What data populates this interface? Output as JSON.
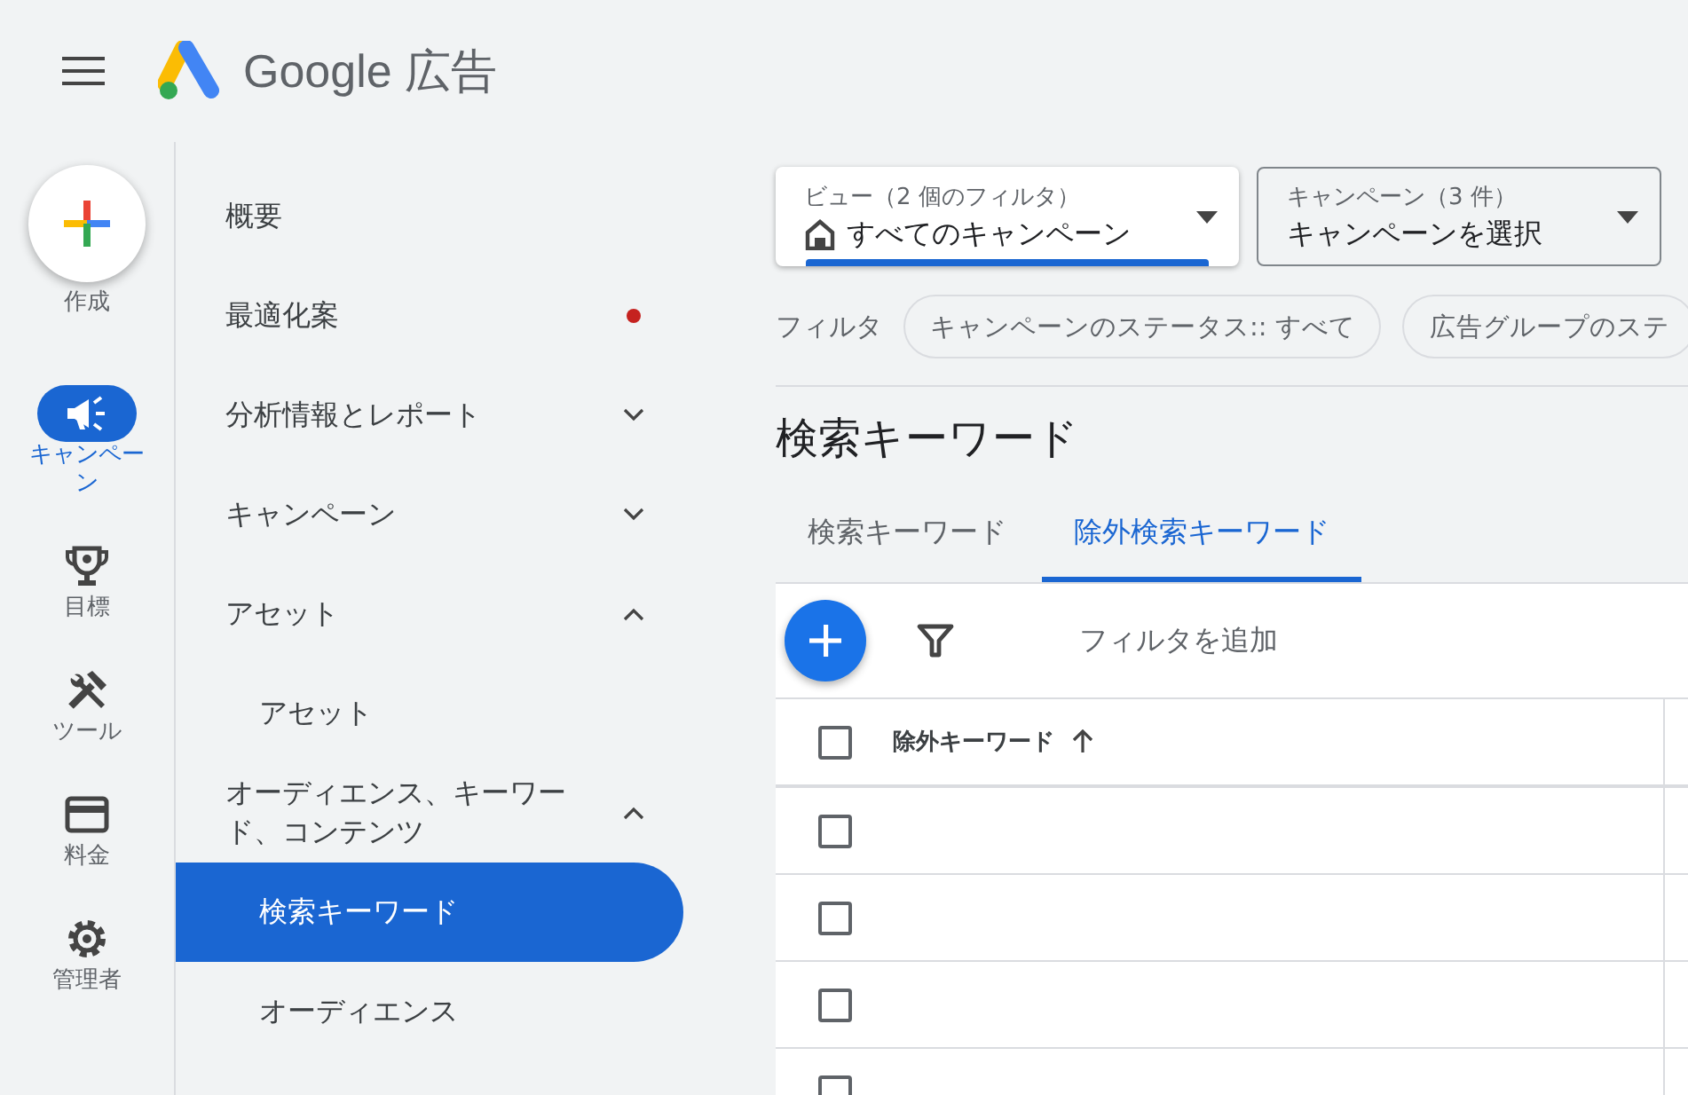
{
  "header": {
    "product": "Google 広告"
  },
  "rail": [
    {
      "kind": "create",
      "label": "作成"
    },
    {
      "kind": "campaign",
      "label": "キャンペーン",
      "selected": true
    },
    {
      "kind": "goal",
      "label": "目標",
      "selected": false
    },
    {
      "kind": "tools",
      "label": "ツール",
      "selected": false
    },
    {
      "kind": "billing",
      "label": "料金",
      "selected": false
    },
    {
      "kind": "admin",
      "label": "管理者",
      "selected": false
    }
  ],
  "nav": [
    {
      "label": "概要",
      "selected": false
    },
    {
      "label": "最適化案",
      "selected": false,
      "notification": true
    },
    {
      "label": "分析情報とレポート",
      "selected": false,
      "expanded": false
    },
    {
      "label": "キャンペーン",
      "selected": false,
      "expanded": false
    },
    {
      "label": "アセット",
      "selected": false,
      "expanded": true,
      "children": [
        {
          "label": "アセット",
          "selected": false
        }
      ]
    },
    {
      "label": "オーディエンス、キーワード、コンテンツ",
      "selected": false,
      "expanded": true,
      "children": [
        {
          "label": "検索キーワード",
          "selected": true
        },
        {
          "label": "オーディエンス",
          "selected": false
        }
      ]
    }
  ],
  "view_select": {
    "label": "ビュー（2 個のフィルタ）",
    "value": "すべてのキャンペーン"
  },
  "campaign_select": {
    "label": "キャンペーン（3 件）",
    "value": "キャンペーンを選択"
  },
  "filters": {
    "label": "フィルタ",
    "chips": [
      "キャンペーンのステータス:: すべて",
      "広告グループのステ"
    ]
  },
  "page_title": "検索キーワード",
  "tabs": [
    {
      "label": "検索キーワード",
      "selected": false
    },
    {
      "label": "除外検索キーワード",
      "selected": true
    }
  ],
  "toolbar": {
    "filter_placeholder": "フィルタを追加"
  },
  "table": {
    "all_checked": false,
    "columns": [
      {
        "label": "除外キーワード",
        "sort_ascending": true
      }
    ],
    "rows": [
      {
        "checked": false
      },
      {
        "checked": false
      },
      {
        "checked": false
      },
      {
        "checked": false
      }
    ]
  }
}
